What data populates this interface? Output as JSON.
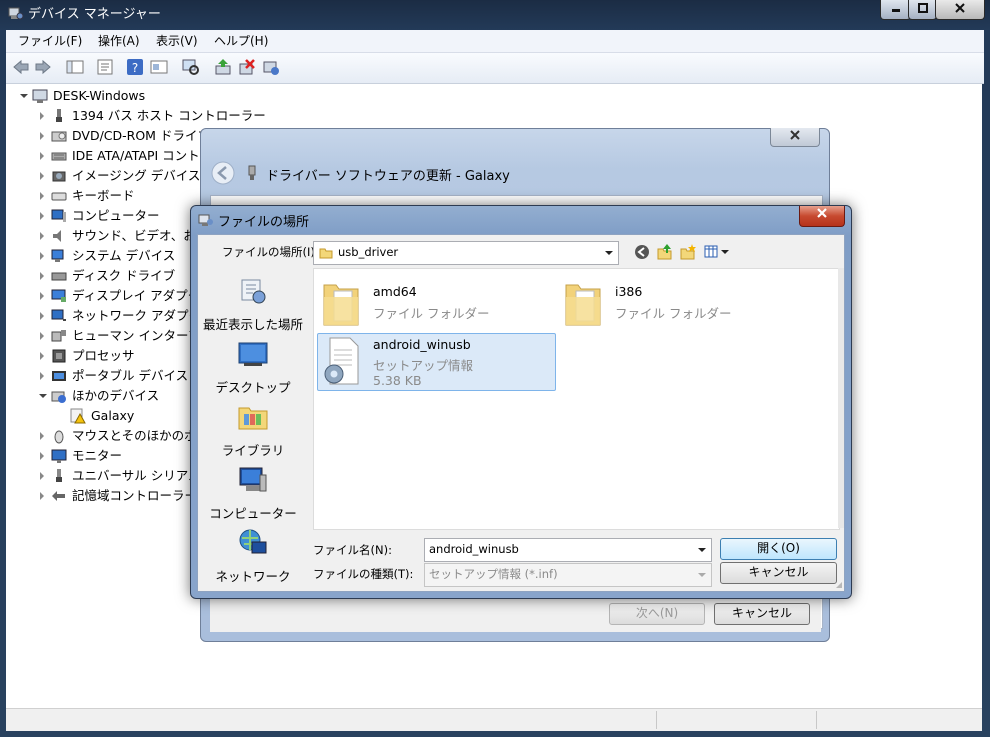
{
  "main_window": {
    "title": "デバイス マネージャー",
    "menu": [
      "ファイル(F)",
      "操作(A)",
      "表示(V)",
      "ヘルプ(H)"
    ],
    "tree": {
      "root": "DESK-Windows",
      "items": [
        {
          "label": "1394 バス ホスト コントローラー",
          "icon": "port-icon"
        },
        {
          "label": "DVD/CD-ROM ドライブ",
          "icon": "dvd-icon"
        },
        {
          "label": "IDE ATA/ATAPI コントローラー",
          "icon": "ide-icon"
        },
        {
          "label": "イメージング デバイス",
          "icon": "camera-icon"
        },
        {
          "label": "キーボード",
          "icon": "keyboard-icon"
        },
        {
          "label": "コンピューター",
          "icon": "computer-icon"
        },
        {
          "label": "サウンド、ビデオ、お",
          "icon": "speaker-icon"
        },
        {
          "label": "システム デバイス",
          "icon": "system-icon"
        },
        {
          "label": "ディスク ドライブ",
          "icon": "disk-icon"
        },
        {
          "label": "ディスプレイ アダプター",
          "icon": "display-icon"
        },
        {
          "label": "ネットワーク アダプター",
          "icon": "network-icon"
        },
        {
          "label": "ヒューマン インターフェイス",
          "icon": "hid-icon"
        },
        {
          "label": "プロセッサ",
          "icon": "cpu-icon"
        },
        {
          "label": "ポータブル デバイス",
          "icon": "portable-icon"
        },
        {
          "label": "ほかのデバイス",
          "icon": "unknown-device-icon",
          "expanded": true,
          "children": [
            "Galaxy"
          ]
        },
        {
          "label": "マウスとそのほかのポインティング",
          "icon": "mouse-icon"
        },
        {
          "label": "モニター",
          "icon": "monitor-icon"
        },
        {
          "label": "ユニバーサル シリアル バス",
          "icon": "usb-icon"
        },
        {
          "label": "記憶域コントローラー",
          "icon": "storage-icon"
        }
      ]
    }
  },
  "wizard": {
    "title": "ドライバー ソフトウェアの更新 - Galaxy",
    "next_label": "次へ(N)",
    "cancel_label": "キャンセル"
  },
  "file_dialog": {
    "title": "ファイルの場所",
    "location_label": "ファイルの場所(I):",
    "location_value": "usb_driver",
    "places": [
      "最近表示した場所",
      "デスクトップ",
      "ライブラリ",
      "コンピューター",
      "ネットワーク"
    ],
    "files": [
      {
        "name": "amd64",
        "type": "ファイル フォルダー"
      },
      {
        "name": "i386",
        "type": "ファイル フォルダー"
      },
      {
        "name": "android_winusb",
        "type": "セットアップ情報",
        "size": "5.38 KB"
      }
    ],
    "filename_label": "ファイル名(N):",
    "filename_value": "android_winusb",
    "filetype_label": "ファイルの種類(T):",
    "filetype_value": "セットアップ情報 (*.inf)",
    "open_label": "開く(O)",
    "cancel_label": "キャンセル"
  },
  "colors": {
    "selection": "#dbe9f8",
    "selection_border": "#7eb4ea",
    "close_red": "#c74a30"
  }
}
